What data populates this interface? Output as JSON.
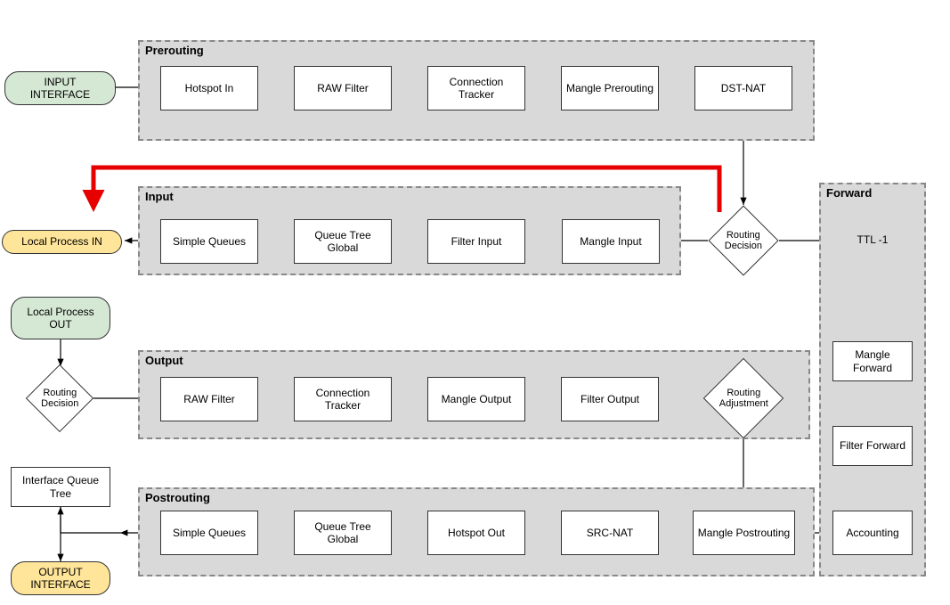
{
  "labels": {
    "prerouting": "Prerouting",
    "input": "Input",
    "output": "Output",
    "postrouting": "Postrouting",
    "forward": "Forward"
  },
  "nodes": {
    "input_if": "INPUT\nINTERFACE",
    "hotspot_in": "Hotspot In",
    "raw_filter_pre": "RAW Filter",
    "conn_tracker_pre": "Connection Tracker",
    "mangle_pre": "Mangle Prerouting",
    "dst_nat": "DST-NAT",
    "routing_decision": "Routing Decision",
    "ttl": "TTL -1",
    "mangle_fwd": "Mangle Forward",
    "filter_fwd": "Filter Forward",
    "accounting": "Accounting",
    "mangle_input": "Mangle Input",
    "filter_input": "Filter Input",
    "qtree_global_in": "Queue Tree Global",
    "simple_queues_in": "Simple Queues",
    "local_in": "Local Process IN",
    "local_out": "Local Process OUT",
    "routing_decision2": "Routing Decision",
    "raw_filter_out": "RAW Filter",
    "conn_tracker_out": "Connection Tracker",
    "mangle_out": "Mangle Output",
    "filter_out": "Filter Output",
    "routing_adjust": "Routing Adjustment",
    "mangle_post": "Mangle Postrouting",
    "src_nat": "SRC-NAT",
    "hotspot_out": "Hotspot Out",
    "qtree_global_post": "Queue Tree Global",
    "simple_queues_post": "Simple Queues",
    "if_qtree": "Interface Queue Tree",
    "output_if": "OUTPUT INTERFACE"
  }
}
